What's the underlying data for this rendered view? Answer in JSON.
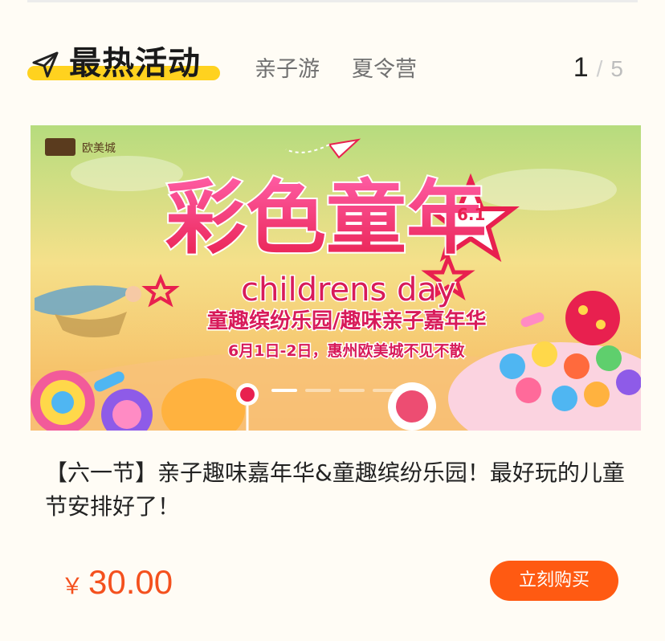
{
  "colors": {
    "accent": "#ff5a12",
    "price": "#f4511e",
    "highlight": "#ffd21f",
    "page_background": "#fffcf5"
  },
  "header": {
    "icon": "navigation-arrow-icon",
    "title": "最热活动",
    "tabs": [
      {
        "label": "亲子游"
      },
      {
        "label": "夏令营"
      }
    ],
    "pager": {
      "current": "1",
      "separator": "/",
      "total": "5"
    }
  },
  "banner": {
    "logo_text": "欧美城",
    "headline": "彩色童年",
    "badge": "6.1",
    "subtitle_en": "childrens day",
    "line1": "童趣缤纷乐园/趣味亲子嘉年华",
    "line2": "6月1日-2日，惠州欧美城不见不散",
    "carousel": {
      "dot_count": 4,
      "active_index": 0
    }
  },
  "activity": {
    "description": "【六一节】亲子趣味嘉年华&童趣缤纷乐园！最好玩的儿童节安排好了！",
    "price_symbol": "￥",
    "price": "30.00",
    "buy_label": "立刻购买"
  }
}
